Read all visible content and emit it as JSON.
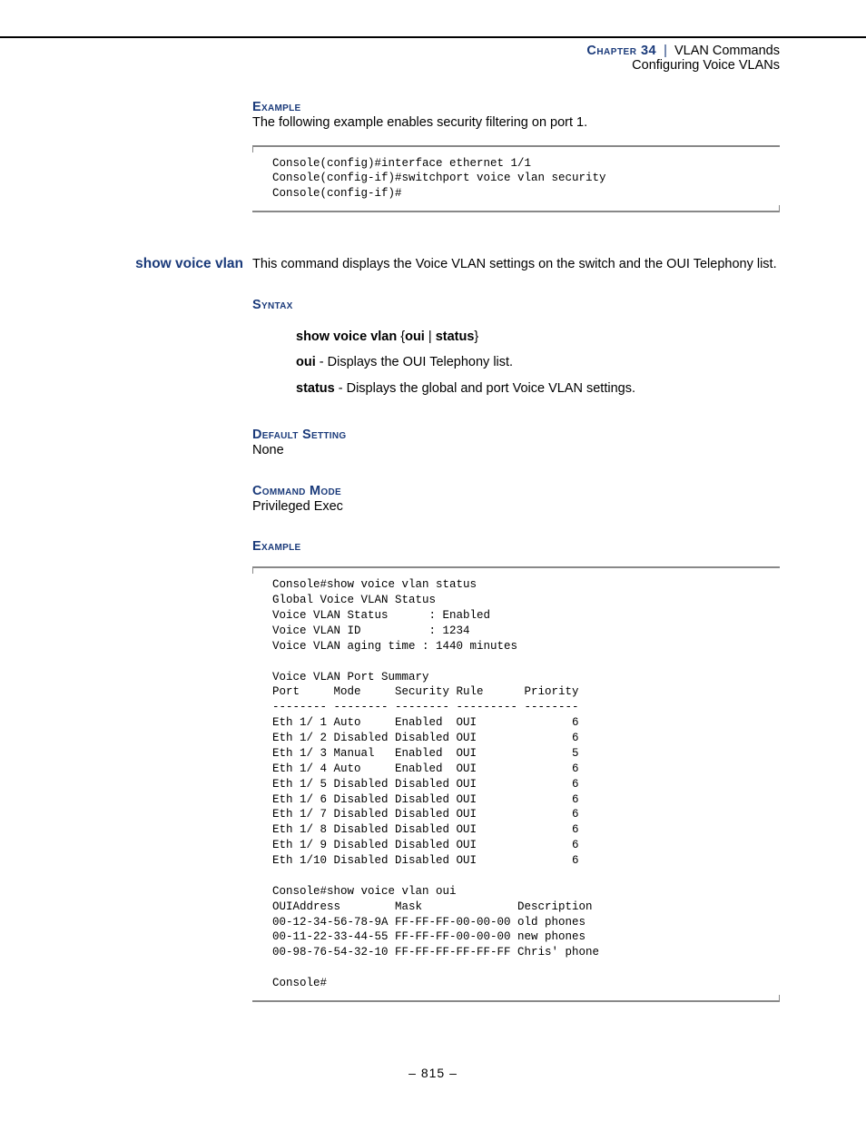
{
  "header": {
    "chapter_label": "Chapter 34",
    "separator": "|",
    "chapter_title": "VLAN Commands",
    "subtitle": "Configuring Voice VLANs"
  },
  "section1": {
    "heading": "Example",
    "text": "The following example enables security filtering on port 1.",
    "code": "Console(config)#interface ethernet 1/1\nConsole(config-if)#switchport voice vlan security\nConsole(config-if)#"
  },
  "command": {
    "side_label": "show voice vlan",
    "intro": "This command displays the Voice VLAN settings on the switch and the OUI Telephony list."
  },
  "syntax": {
    "heading": "Syntax",
    "line": "show voice vlan",
    "braces_open": "{",
    "opt1": "oui",
    "pipe": "|",
    "opt2": "status",
    "braces_close": "}",
    "def_oui_b": "oui",
    "def_oui_t": " - Displays the OUI Telephony list.",
    "def_status_b": "status",
    "def_status_t": " - Displays the global and port Voice VLAN settings."
  },
  "default_setting": {
    "heading": "Default Setting",
    "value": "None"
  },
  "command_mode": {
    "heading": "Command Mode",
    "value": "Privileged Exec"
  },
  "example2": {
    "heading": "Example",
    "code": "Console#show voice vlan status\nGlobal Voice VLAN Status\nVoice VLAN Status      : Enabled\nVoice VLAN ID          : 1234\nVoice VLAN aging time : 1440 minutes\n\nVoice VLAN Port Summary\nPort     Mode     Security Rule      Priority\n-------- -------- -------- --------- --------\nEth 1/ 1 Auto     Enabled  OUI              6\nEth 1/ 2 Disabled Disabled OUI              6\nEth 1/ 3 Manual   Enabled  OUI              5\nEth 1/ 4 Auto     Enabled  OUI              6\nEth 1/ 5 Disabled Disabled OUI              6\nEth 1/ 6 Disabled Disabled OUI              6\nEth 1/ 7 Disabled Disabled OUI              6\nEth 1/ 8 Disabled Disabled OUI              6\nEth 1/ 9 Disabled Disabled OUI              6\nEth 1/10 Disabled Disabled OUI              6\n\nConsole#show voice vlan oui\nOUIAddress        Mask              Description\n00-12-34-56-78-9A FF-FF-FF-00-00-00 old phones\n00-11-22-33-44-55 FF-FF-FF-00-00-00 new phones\n00-98-76-54-32-10 FF-FF-FF-FF-FF-FF Chris' phone\n\nConsole#"
  },
  "footer": {
    "page": "–  815  –"
  }
}
